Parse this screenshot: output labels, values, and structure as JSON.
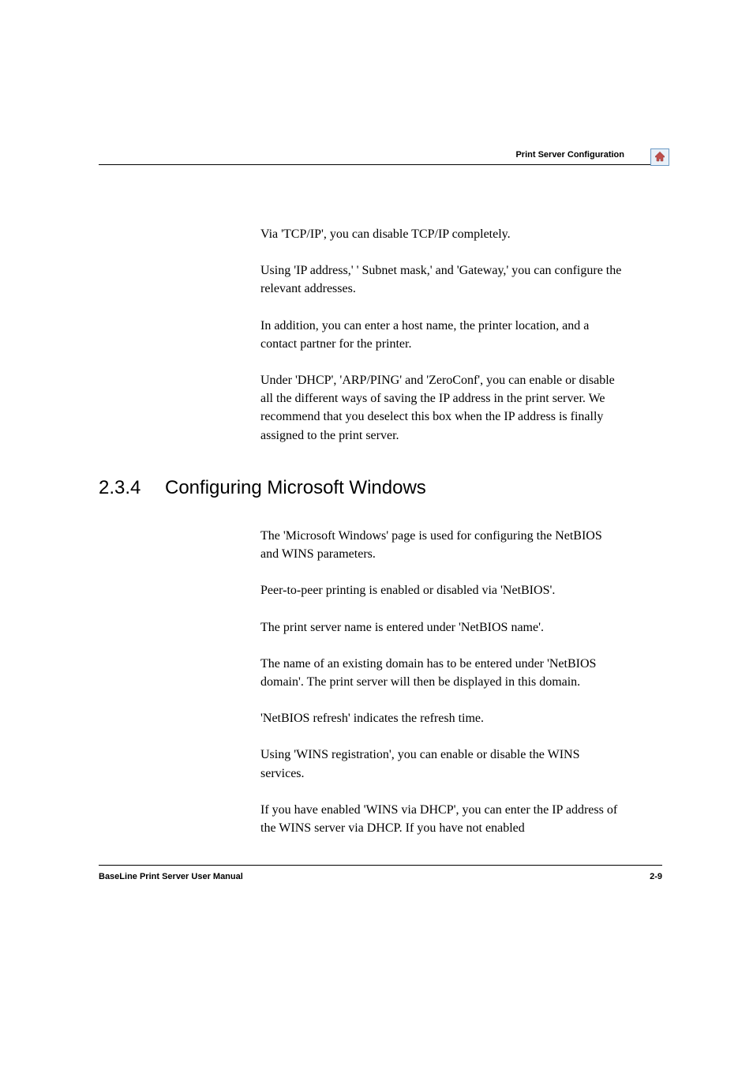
{
  "header": {
    "title": "Print Server Configuration"
  },
  "content": {
    "para1": "Via 'TCP/IP', you can disable TCP/IP completely.",
    "para2": "Using 'IP  address,' ' Subnet mask,' and 'Gateway,' you can configure the relevant addresses.",
    "para3": "In addition, you can enter a host name, the printer location, and a contact partner for the printer.",
    "para4": "Under 'DHCP', 'ARP/PING' and 'ZeroConf', you can enable or disable all the different ways of saving the IP address in the print server. We recommend that you deselect this box when the IP address is finally assigned to the print server."
  },
  "section": {
    "number": "2.3.4",
    "title": "Configuring Microsoft Windows"
  },
  "content2": {
    "para1": "The 'Microsoft Windows' page is used for configuring the NetBIOS and WINS parameters.",
    "para2": "Peer-to-peer printing is enabled or disabled via 'NetBIOS'.",
    "para3": "The print server name is entered under 'NetBIOS name'.",
    "para4": "The name of an existing domain has to be entered under 'NetBIOS domain'. The print server will then be displayed in this domain.",
    "para5": "'NetBIOS refresh' indicates the refresh time.",
    "para6": "Using 'WINS registration', you can enable or disable the WINS services.",
    "para7": "If you have enabled 'WINS via DHCP', you can enter the IP address of the WINS server via DHCP. If you have not enabled"
  },
  "footer": {
    "left": "BaseLine Print Server User Manual",
    "right": "2-9"
  }
}
